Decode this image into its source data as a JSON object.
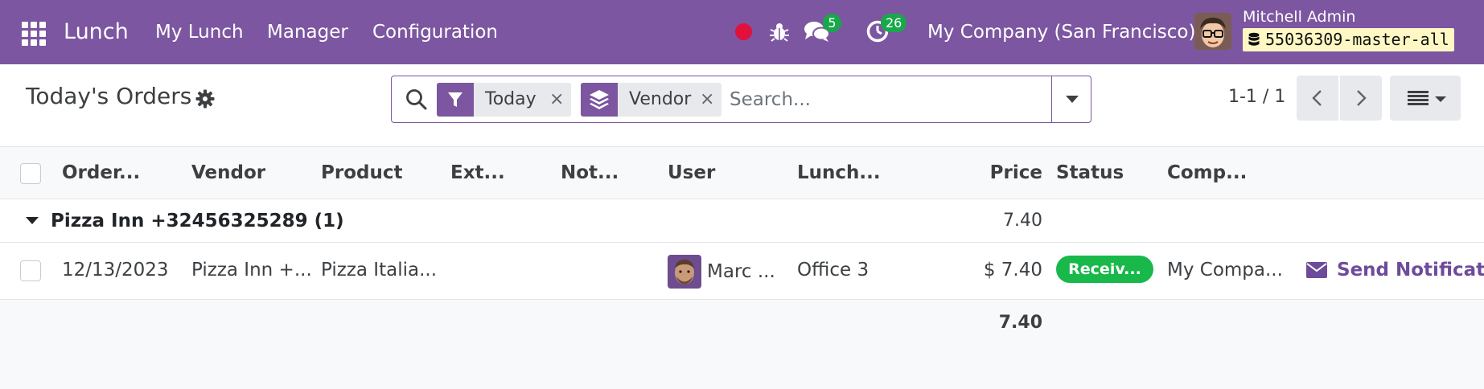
{
  "navbar": {
    "app_name": "Lunch",
    "menus": [
      "My Lunch",
      "Manager",
      "Configuration"
    ],
    "chat_count": "5",
    "activity_count": "26",
    "company": "My Company (San Francisco)",
    "user_name": "Mitchell Admin",
    "database": "55036309-master-all",
    "icons": [
      "apps-grid-icon",
      "recording-dot-icon",
      "bug-icon",
      "chat-icon",
      "activity-clock-icon",
      "database-icon"
    ],
    "colors": {
      "brand": "#7c56a0",
      "recording": "#e0113b",
      "badge": "#18a84a",
      "db_badge_bg": "#fff8c4"
    }
  },
  "control_panel": {
    "title": "Today's Orders",
    "facets": [
      {
        "icon": "filter-icon",
        "label": "Today"
      },
      {
        "icon": "group-by-layers-icon",
        "label": "Vendor"
      }
    ],
    "search_placeholder": "Search...",
    "pager": "1-1 / 1"
  },
  "list": {
    "columns": [
      "Order...",
      "Vendor",
      "Product",
      "Ext...",
      "Not...",
      "User",
      "Lunch...",
      "Price",
      "Status",
      "Comp..."
    ],
    "group": {
      "name": "Pizza Inn +32456325289 (1)",
      "total": "7.40"
    },
    "rows": [
      {
        "date": "12/13/2023",
        "vendor": "Pizza Inn +...",
        "product": "Pizza Italia...",
        "extras": "",
        "notes": "",
        "user": "Marc ...",
        "location": "Office 3",
        "price": "$ 7.40",
        "status": "Receiv...",
        "company": "My Compa...",
        "action": "Send Notificatio"
      }
    ],
    "footer_total": "7.40",
    "colors": {
      "status_received": "#18b84a",
      "action": "#6e4b9a"
    }
  }
}
